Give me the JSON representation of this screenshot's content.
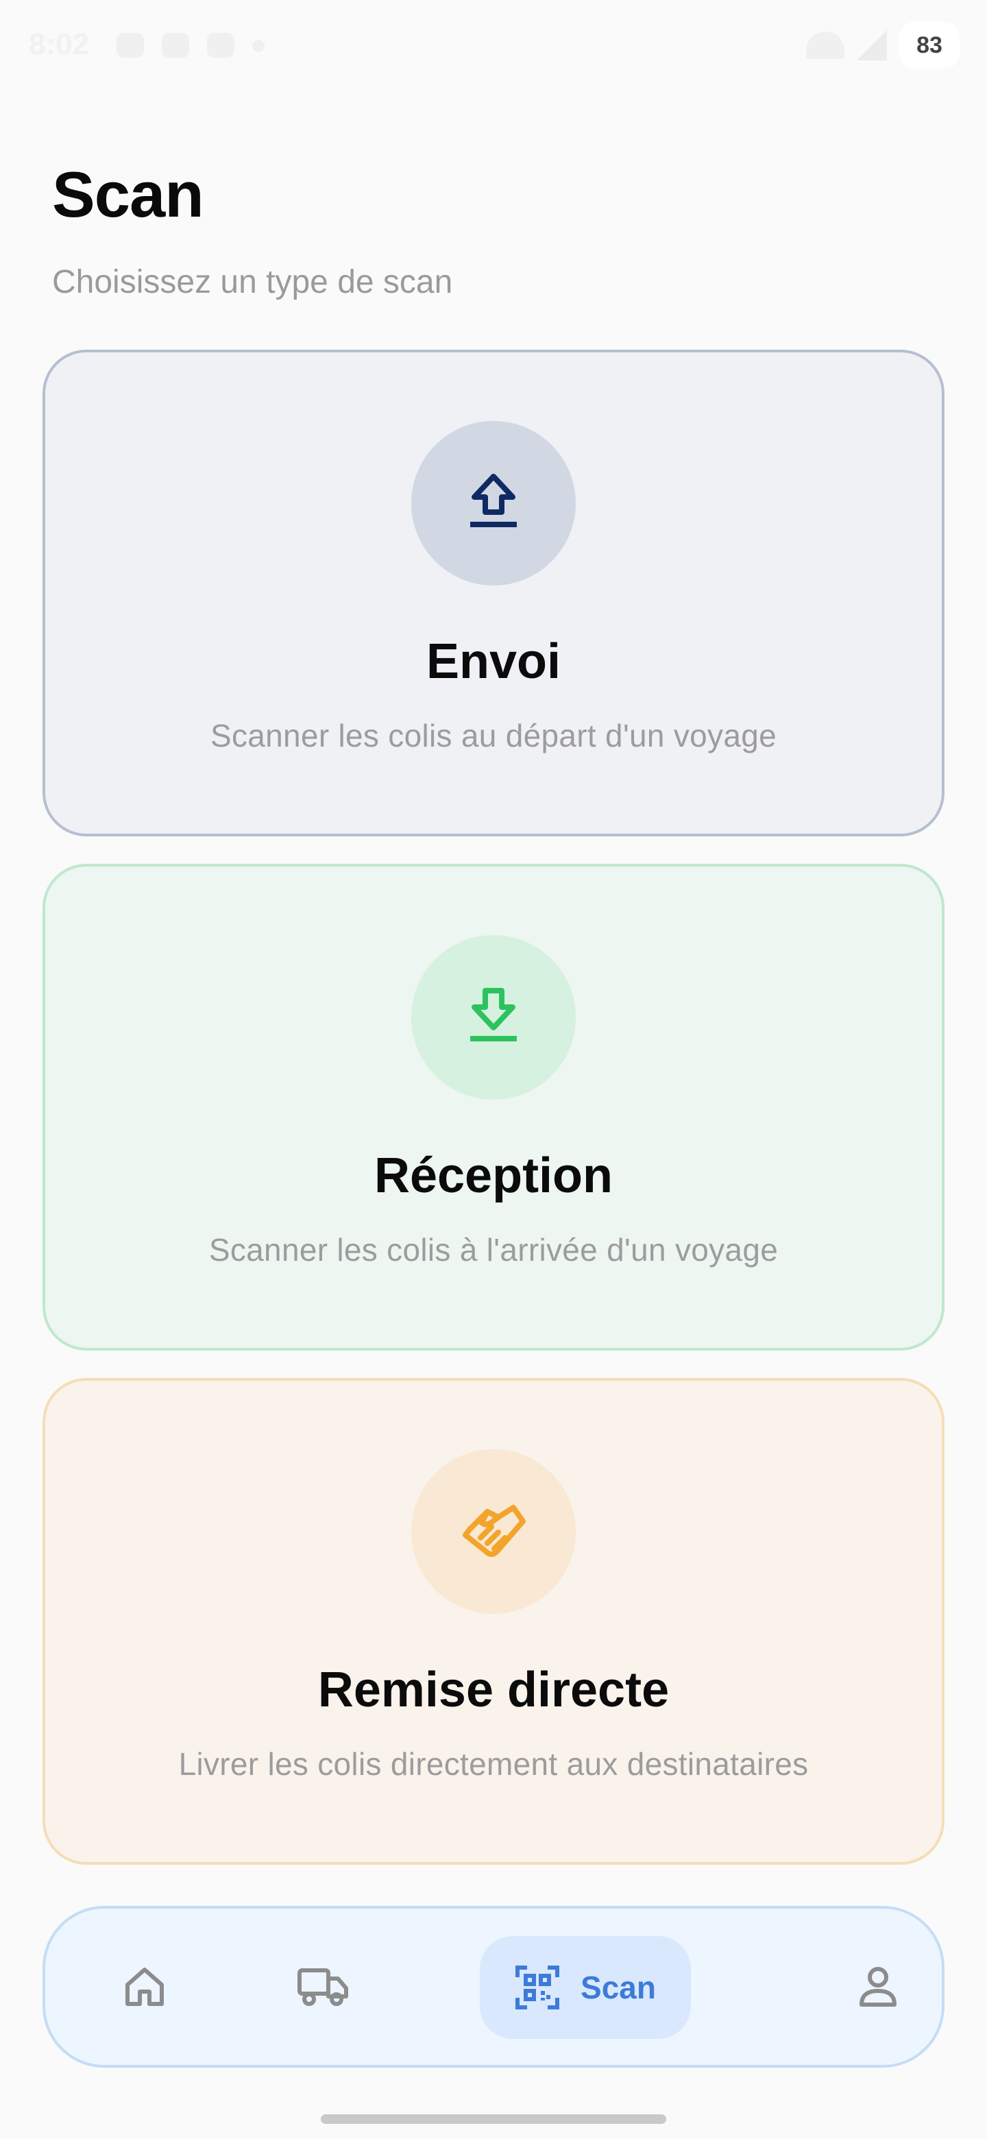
{
  "status_bar": {
    "time": "8:02",
    "battery": "83"
  },
  "header": {
    "title": "Scan",
    "subtitle": "Choisissez un type de scan"
  },
  "cards": [
    {
      "title": "Envoi",
      "description": "Scanner les colis au départ d'un voyage",
      "icon": "upload-icon",
      "accent": "#0f2a63"
    },
    {
      "title": "Réception",
      "description": "Scanner les colis à l'arrivée d'un voyage",
      "icon": "download-icon",
      "accent": "#2cc35f"
    },
    {
      "title": "Remise directe",
      "description": "Livrer les colis directement aux destinataires",
      "icon": "handshake-icon",
      "accent": "#f2a42b"
    }
  ],
  "bottom_nav": {
    "items": [
      {
        "icon": "home-icon",
        "label": ""
      },
      {
        "icon": "truck-icon",
        "label": ""
      },
      {
        "icon": "qr-scan-icon",
        "label": "Scan",
        "active": true
      },
      {
        "icon": "profile-icon",
        "label": ""
      }
    ],
    "active_color": "#3e7bd8",
    "inactive_color": "#8c8c8c"
  }
}
